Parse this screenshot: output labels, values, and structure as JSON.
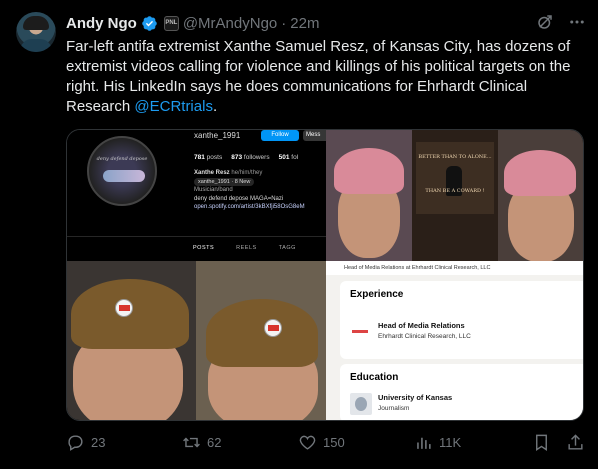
{
  "author": {
    "name": "Andy Ngo",
    "handle": "@MrAndyNgo",
    "separator": "·",
    "time": "22m",
    "affiliate_badge": "PNL"
  },
  "tweet": {
    "text": "Far-left antifa extremist Xanthe Samuel Resz, of Kansas City, has dozens of extremist videos calling for violence and killings of his political targets on the right. His LinkedIn says he does communications for Ehrhardt Clinical Research ",
    "mention": "@ECRtrials",
    "trailing": "."
  },
  "media": {
    "instagram": {
      "username": "xanthe_1991",
      "follow_label": "Follow",
      "message_label": "Mess",
      "posts_count": "781",
      "posts_label": "posts",
      "followers_count": "873",
      "followers_label": "followers",
      "following_count": "501",
      "following_label": "fol",
      "bio_name": "Xanthe Resz",
      "pronouns": "he/him/they",
      "threads_pill": "xanthe_1991 · 8 New",
      "category": "Musician/band",
      "bio_line": "deny defend depose MAGA=Nazi",
      "link": "open.spotify.com/artist/3kBXfji58OsG8eM",
      "profile_caption": "deny defend depose",
      "tabs": [
        "POSTS",
        "REELS",
        "TAGG"
      ]
    },
    "poster": {
      "top_text": "BETTER THAN TO ALONE...",
      "bottom_text": "THAN BE A COWARD !"
    },
    "linkedin": {
      "headline": "Head of Media Relations at Ehrhardt Clinical Research, LLC",
      "experience_heading": "Experience",
      "job_title": "Head of Media Relations",
      "company": "Ehrhardt Clinical Research, LLC",
      "education_heading": "Education",
      "school": "University of Kansas",
      "field": "Journalism"
    }
  },
  "actions": {
    "replies": "23",
    "reposts": "62",
    "likes": "150",
    "views": "11K"
  },
  "colors": {
    "background": "#000000",
    "text": "#e7e9ea",
    "muted": "#71767b",
    "accent": "#1d9bf0"
  }
}
